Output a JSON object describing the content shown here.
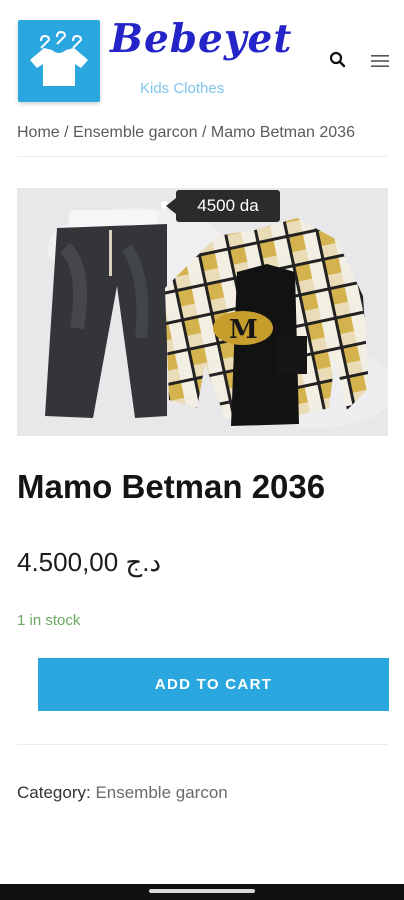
{
  "brand": {
    "name": "Bebeyet",
    "tagline": "Kids Clothes",
    "logo_icon": "clothes-hangers-icon",
    "accent": "#2aa7df",
    "name_color": "#2424c8"
  },
  "header": {
    "search_icon": "search-icon",
    "menu_icon": "hamburger-menu-icon"
  },
  "breadcrumb": {
    "home": "Home",
    "category": "Ensemble garcon",
    "current": "Mamo Betman 2036",
    "separator": " / "
  },
  "product": {
    "image_price_tag": "4500 da",
    "title": "Mamo Betman 2036",
    "price": "4.500,00 د.ج",
    "stock": "1 in stock",
    "add_to_cart": "ADD TO CART",
    "category_label": "Category:",
    "category_value": "Ensemble garcon"
  },
  "colors": {
    "accent": "#2aa7df",
    "in_stock": "#6aaa5f"
  }
}
